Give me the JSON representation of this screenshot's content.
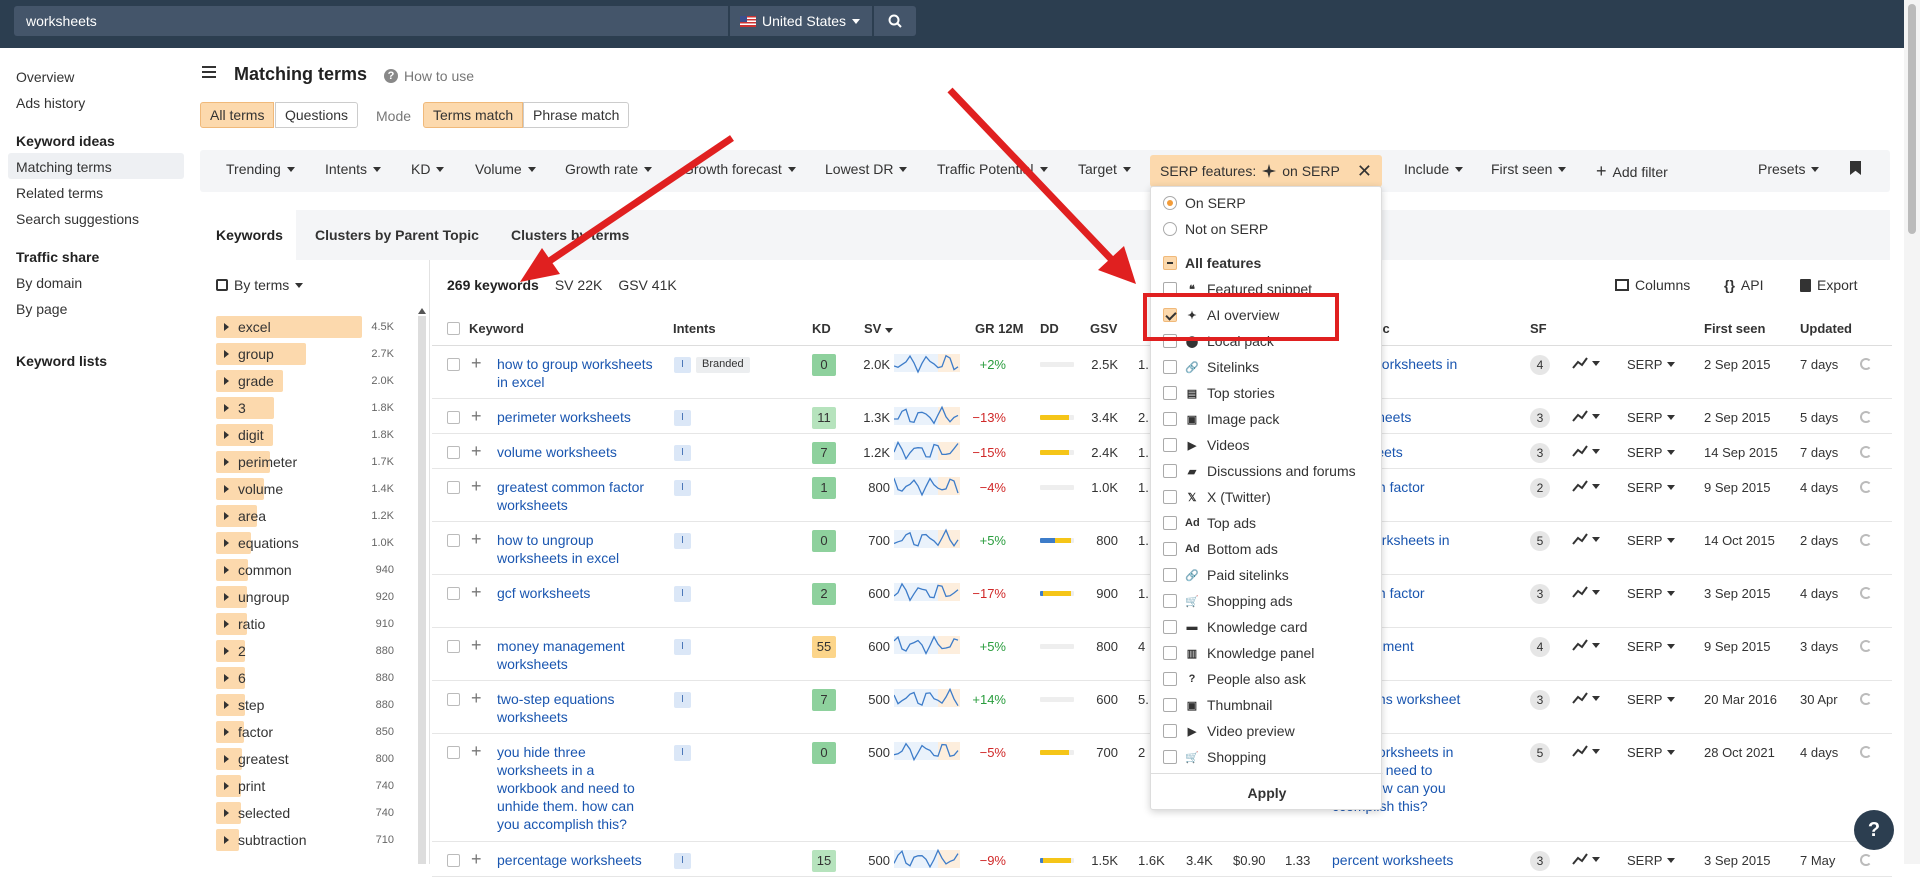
{
  "topbar": {
    "query": "worksheets",
    "country": "United States"
  },
  "sidebar": {
    "items_top": [
      "Overview",
      "Ads history"
    ],
    "keyword_ideas": {
      "heading": "Keyword ideas",
      "items": [
        "Matching terms",
        "Related terms",
        "Search suggestions"
      ]
    },
    "traffic_share": {
      "heading": "Traffic share",
      "items": [
        "By domain",
        "By page"
      ]
    },
    "keyword_lists": "Keyword lists"
  },
  "header": {
    "title": "Matching terms",
    "how_to": "How to use"
  },
  "segments": {
    "all_terms": "All terms",
    "questions": "Questions",
    "mode": "Mode",
    "terms_match": "Terms match",
    "phrase_match": "Phrase match"
  },
  "filters": [
    "Trending",
    "Intents",
    "KD",
    "Volume",
    "Growth rate",
    "Growth forecast",
    "Lowest DR",
    "Traffic Potential",
    "Target"
  ],
  "serp_chip": {
    "label": "SERP features:",
    "value": "on SERP"
  },
  "filters_right": {
    "include": "Include",
    "first_seen": "First seen",
    "add_filter": "Add filter",
    "presets": "Presets"
  },
  "tabs": [
    "Keywords",
    "Clusters by Parent Topic",
    "Clusters by terms"
  ],
  "terms_panel": {
    "mode": "By terms",
    "terms": [
      {
        "label": "excel",
        "count": "4.5K",
        "pct": 100
      },
      {
        "label": "group",
        "count": "2.7K",
        "pct": 62
      },
      {
        "label": "grade",
        "count": "2.0K",
        "pct": 46
      },
      {
        "label": "3",
        "count": "1.8K",
        "pct": 40
      },
      {
        "label": "digit",
        "count": "1.8K",
        "pct": 39
      },
      {
        "label": "perimeter",
        "count": "1.7K",
        "pct": 37
      },
      {
        "label": "volume",
        "count": "1.4K",
        "pct": 33
      },
      {
        "label": "area",
        "count": "1.2K",
        "pct": 28
      },
      {
        "label": "equations",
        "count": "1.0K",
        "pct": 24
      },
      {
        "label": "common",
        "count": "940",
        "pct": 22
      },
      {
        "label": "ungroup",
        "count": "920",
        "pct": 21
      },
      {
        "label": "ratio",
        "count": "910",
        "pct": 21
      },
      {
        "label": "2",
        "count": "880",
        "pct": 20
      },
      {
        "label": "6",
        "count": "880",
        "pct": 20
      },
      {
        "label": "step",
        "count": "880",
        "pct": 20
      },
      {
        "label": "factor",
        "count": "850",
        "pct": 19
      },
      {
        "label": "greatest",
        "count": "800",
        "pct": 18
      },
      {
        "label": "print",
        "count": "740",
        "pct": 17
      },
      {
        "label": "selected",
        "count": "740",
        "pct": 17
      },
      {
        "label": "subtraction",
        "count": "710",
        "pct": 16
      }
    ]
  },
  "summary": {
    "keywords": "269 keywords",
    "sv": "SV 22K",
    "gsv": "GSV 41K"
  },
  "table_actions": {
    "columns": "Columns",
    "api": "API",
    "export": "Export"
  },
  "columns": {
    "keyword": "Keyword",
    "intents": "Intents",
    "kd": "KD",
    "sv": "SV",
    "gr": "GR 12M",
    "dd": "DD",
    "gsv": "GSV",
    "topic": "Topic",
    "sf": "SF",
    "first_seen": "First seen",
    "updated": "Updated"
  },
  "rows": [
    {
      "kw": [
        "how to group worksheets",
        "in excel"
      ],
      "branded": "Branded",
      "kd": "0",
      "kdc": "#8ed19d",
      "sv": "2.0K",
      "gr": "+2%",
      "pos": true,
      "dd": [
        0,
        0
      ],
      "gsv": "2.5K",
      "gcol": "1.",
      "topic": [
        "group worksheets in",
        ""
      ],
      "sf": "4",
      "fs": "2 Sep 2015",
      "up": "7 days"
    },
    {
      "kw": [
        "perimeter worksheets"
      ],
      "kd": "11",
      "kdc": "#b6e3bd",
      "sv": "1.3K",
      "gr": "−13%",
      "pos": false,
      "dd": [
        0,
        85
      ],
      "gsv": "3.4K",
      "gcol": "2.",
      "topic": [
        "r worksheets"
      ],
      "sf": "3",
      "fs": "2 Sep 2015",
      "up": "5 days"
    },
    {
      "kw": [
        "volume worksheets"
      ],
      "kd": "7",
      "kdc": "#8ed19d",
      "sv": "1.2K",
      "gr": "−15%",
      "pos": false,
      "dd": [
        0,
        85
      ],
      "gsv": "2.4K",
      "gcol": "1.",
      "topic": [
        "worksheets"
      ],
      "sf": "3",
      "fs": "14 Sep 2015",
      "up": "7 days"
    },
    {
      "kw": [
        "greatest common factor",
        "worksheets"
      ],
      "kd": "1",
      "kdc": "#8ed19d",
      "sv": "800",
      "gr": "−4%",
      "pos": false,
      "dd": [
        0,
        0
      ],
      "gsv": "1.0K",
      "gcol": "1.",
      "topic": [
        "common factor",
        "et"
      ],
      "sf": "2",
      "fs": "9 Sep 2015",
      "up": "4 days"
    },
    {
      "kw": [
        "how to ungroup",
        "worksheets in excel"
      ],
      "kd": "0",
      "kdc": "#8ed19d",
      "sv": "700",
      "gr": "+5%",
      "pos": true,
      "dd": [
        45,
        45
      ],
      "gsv": "800",
      "gcol": "1.",
      "topic": [
        "roup worksheets in",
        ""
      ],
      "sf": "5",
      "fs": "14 Oct 2015",
      "up": "2 days"
    },
    {
      "kw": [
        "gcf worksheets"
      ],
      "kd": "2",
      "kdc": "#8ed19d",
      "sv": "600",
      "gr": "−17%",
      "pos": false,
      "dd": [
        10,
        80
      ],
      "gsv": "900",
      "gcol": "1.",
      "topic": [
        "common factor",
        "et"
      ],
      "sf": "3",
      "fs": "3 Sep 2015",
      "up": "4 days"
    },
    {
      "kw": [
        "money management",
        "worksheets"
      ],
      "kd": "55",
      "kdc": "#fcd58a",
      "sv": "600",
      "gr": "+5%",
      "pos": true,
      "dd": [
        0,
        0
      ],
      "gsv": "800",
      "gcol": "4",
      "topic": [
        "management",
        "ets"
      ],
      "sf": "4",
      "fs": "9 Sep 2015",
      "up": "3 days"
    },
    {
      "kw": [
        "two-step equations",
        "worksheets"
      ],
      "kd": "7",
      "kdc": "#8ed19d",
      "sv": "500",
      "gr": "+14%",
      "pos": true,
      "dd": [
        0,
        0
      ],
      "gsv": "600",
      "gcol": "5.",
      "topic": [
        "equations worksheet",
        ""
      ],
      "sf": "3",
      "fs": "20 Mar 2016",
      "up": "30 Apr"
    },
    {
      "kw": [
        "you hide three",
        "worksheets in a",
        "workbook and need to",
        "unhide them. how can",
        "you accomplish this?"
      ],
      "kd": "0",
      "kdc": "#8ed19d",
      "sv": "500",
      "gr": "−5%",
      "pos": false,
      "dd": [
        0,
        85
      ],
      "gsv": "700",
      "gcol": "2",
      "topic": [
        "three worksheets in",
        "ook and need to",
        "hem. how can you",
        "ccomplish this?"
      ],
      "sf": "5",
      "fs": "28 Oct 2021",
      "up": "4 days"
    },
    {
      "kw": [
        "percentage worksheets"
      ],
      "kd": "15",
      "kdc": "#b6e3bd",
      "sv": "500",
      "gr": "−9%",
      "pos": false,
      "dd": [
        10,
        80
      ],
      "gsv": "1.5K",
      "gcol": "1.6K",
      "extra": [
        "3.4K",
        "$0.90",
        "1.33"
      ],
      "topic": [
        "percent worksheets"
      ],
      "sf": "3",
      "fs": "3 Sep 2015",
      "up": "7 May"
    }
  ],
  "serp_label": "SERP",
  "dropdown": {
    "on_serp": "On SERP",
    "not_on_serp": "Not on SERP",
    "all_features": "All features",
    "features": [
      {
        "label": "Featured snippet",
        "icon": "quote-icon",
        "checked": false
      },
      {
        "label": "AI overview",
        "icon": "sparkle-icon",
        "checked": true
      },
      {
        "label": "Local pack",
        "icon": "pin-icon",
        "checked": false
      },
      {
        "label": "Sitelinks",
        "icon": "link-icon",
        "checked": false
      },
      {
        "label": "Top stories",
        "icon": "news-icon",
        "checked": false
      },
      {
        "label": "Image pack",
        "icon": "image-icon",
        "checked": false
      },
      {
        "label": "Videos",
        "icon": "video-icon",
        "checked": false
      },
      {
        "label": "Discussions and forums",
        "icon": "chat-icon",
        "checked": false
      },
      {
        "label": "X (Twitter)",
        "icon": "x-icon",
        "checked": false
      },
      {
        "label": "Top ads",
        "icon": "ad-icon",
        "checked": false
      },
      {
        "label": "Bottom ads",
        "icon": "ad-icon",
        "checked": false
      },
      {
        "label": "Paid sitelinks",
        "icon": "link-icon",
        "checked": false
      },
      {
        "label": "Shopping ads",
        "icon": "cart-icon",
        "checked": false
      },
      {
        "label": "Knowledge card",
        "icon": "card-icon",
        "checked": false
      },
      {
        "label": "Knowledge panel",
        "icon": "panel-icon",
        "checked": false
      },
      {
        "label": "People also ask",
        "icon": "question-icon",
        "checked": false
      },
      {
        "label": "Thumbnail",
        "icon": "image-icon",
        "checked": false
      },
      {
        "label": "Video preview",
        "icon": "play-icon",
        "checked": false
      },
      {
        "label": "Shopping",
        "icon": "cart-icon",
        "checked": false
      }
    ],
    "apply": "Apply"
  },
  "help": "?"
}
